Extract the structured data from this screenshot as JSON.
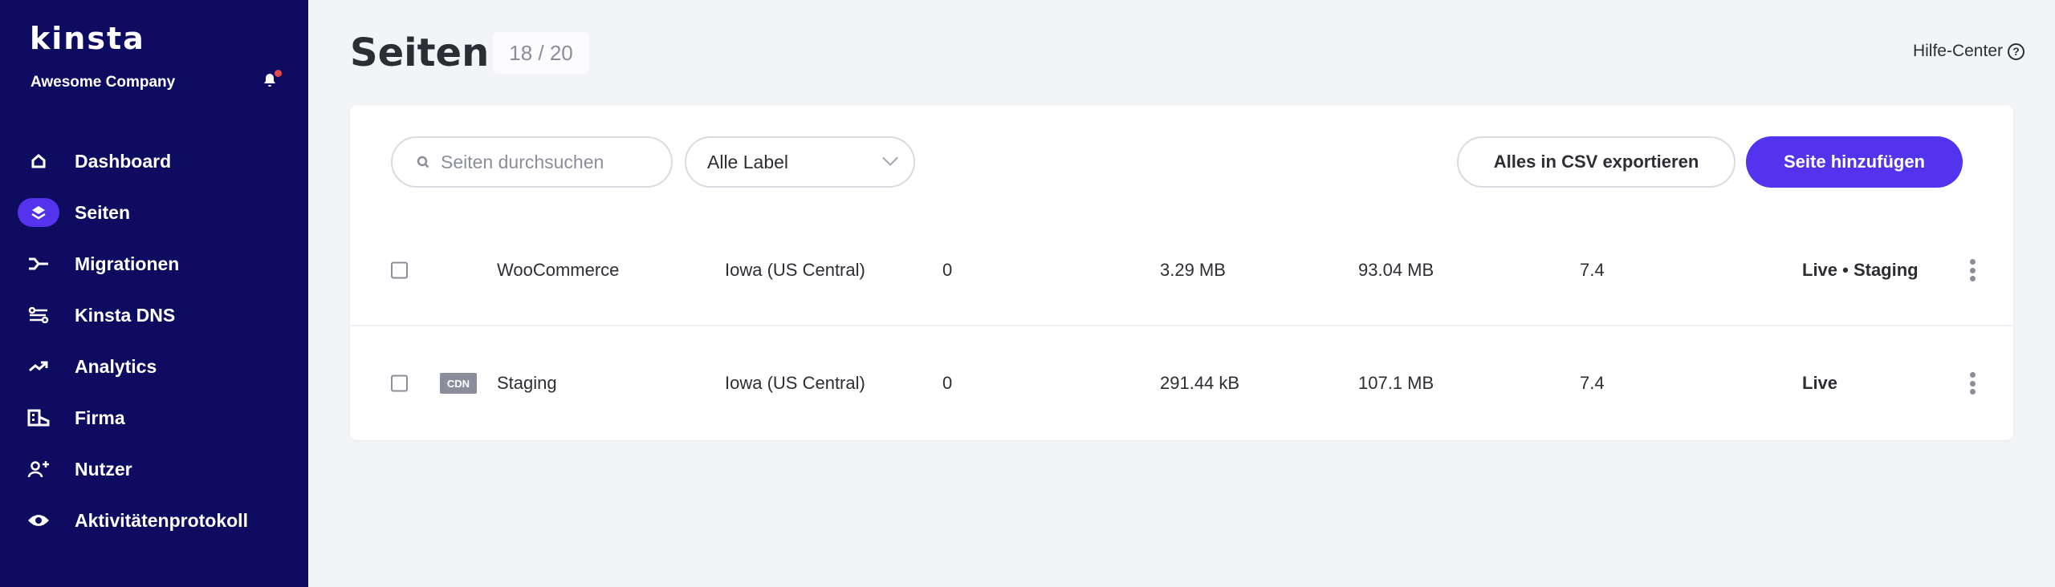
{
  "sidebar": {
    "logo": "kinsta",
    "company": "Awesome Company",
    "items": [
      {
        "label": "Dashboard",
        "icon": "home-icon"
      },
      {
        "label": "Seiten",
        "icon": "layers-icon",
        "active": true
      },
      {
        "label": "Migrationen",
        "icon": "migration-icon"
      },
      {
        "label": "Kinsta DNS",
        "icon": "dns-icon"
      },
      {
        "label": "Analytics",
        "icon": "trend-icon"
      },
      {
        "label": "Firma",
        "icon": "building-icon"
      },
      {
        "label": "Nutzer",
        "icon": "user-add-icon"
      },
      {
        "label": "Aktivitätenprotokoll",
        "icon": "eye-icon"
      }
    ]
  },
  "header": {
    "title": "Seiten",
    "count": "18 / 20",
    "help": "Hilfe-Center"
  },
  "toolbar": {
    "search_placeholder": "Seiten durchsuchen",
    "label_select": "Alle Label",
    "export": "Alles in CSV exportieren",
    "add": "Seite hinzufügen"
  },
  "colors": {
    "accent": "#5333ed",
    "sidebar": "#0e0c60"
  },
  "sites": [
    {
      "name": "WooCommerce",
      "cdn": "",
      "location": "Iowa (US Central)",
      "visits": "0",
      "disk": "3.29 MB",
      "bandwidth": "93.04 MB",
      "php": "7.4",
      "env": "Live • Staging"
    },
    {
      "name": "Staging",
      "cdn": "CDN",
      "location": "Iowa (US Central)",
      "visits": "0",
      "disk": "291.44 kB",
      "bandwidth": "107.1 MB",
      "php": "7.4",
      "env": "Live"
    }
  ]
}
